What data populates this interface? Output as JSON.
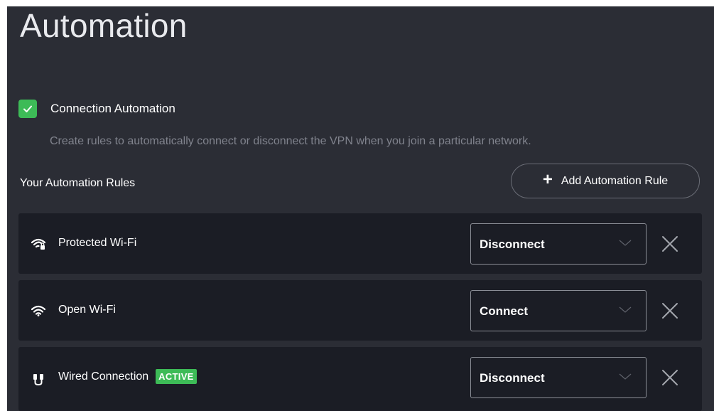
{
  "page": {
    "title": "Automation"
  },
  "connection_automation": {
    "checked": true,
    "label": "Connection Automation",
    "description": "Create rules to automatically connect or disconnect the VPN when you join a particular network."
  },
  "rules_section": {
    "heading": "Your Automation Rules",
    "add_button_label": "Add Automation Rule",
    "add_button_icon": "plus-icon"
  },
  "rules": [
    {
      "name": "Protected Wi-Fi",
      "icon": "protected-wifi-icon",
      "action": "Disconnect",
      "badge": ""
    },
    {
      "name": "Open Wi-Fi",
      "icon": "wifi-icon",
      "action": "Connect",
      "badge": ""
    },
    {
      "name": "Wired Connection",
      "icon": "ethernet-icon",
      "action": "Disconnect",
      "badge": "ACTIVE"
    }
  ],
  "colors": {
    "panel_background": "#2b2d35",
    "row_background": "#1b1d25",
    "accent_green": "#3dbb57",
    "muted_text": "#80838d"
  }
}
